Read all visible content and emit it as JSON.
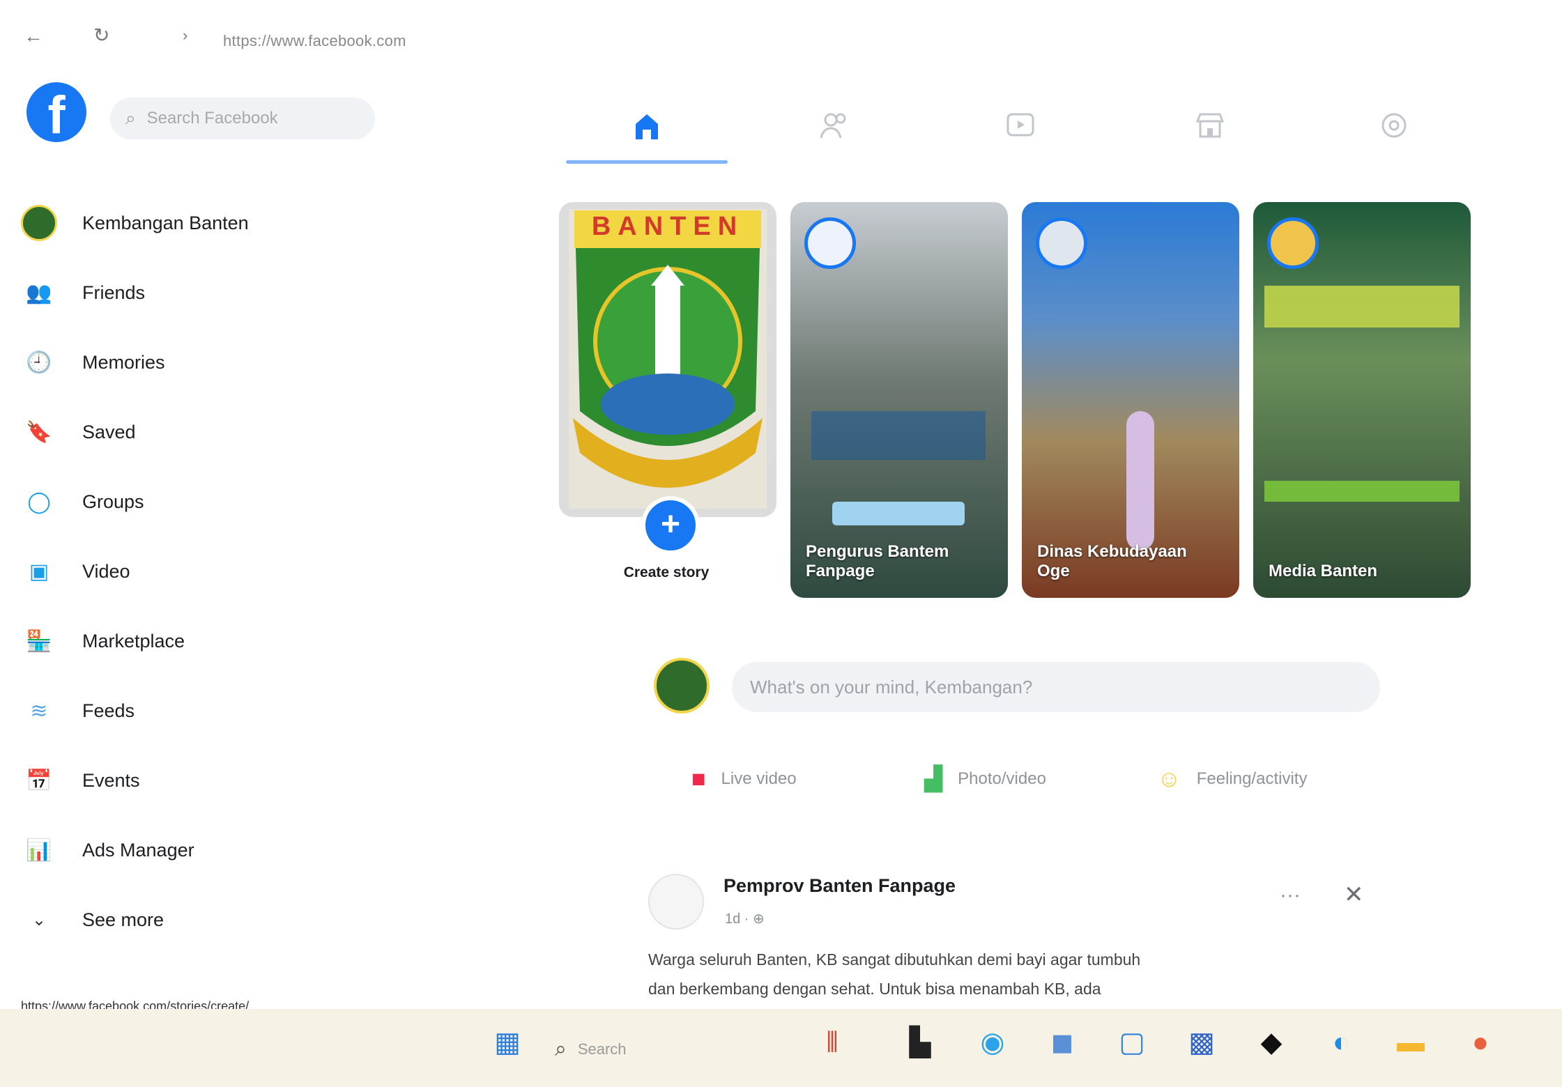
{
  "browser": {
    "back_icon": "back-arrow-icon",
    "reload_icon": "reload-icon",
    "url": "https://www.facebook.com"
  },
  "header": {
    "logo_letter": "f",
    "search_placeholder": "Search Facebook"
  },
  "nav_tabs": [
    {
      "name": "home",
      "icon": "home-icon",
      "active": true
    },
    {
      "name": "friends",
      "icon": "friends-icon",
      "active": false
    },
    {
      "name": "video",
      "icon": "video-icon",
      "active": false
    },
    {
      "name": "marketplace",
      "icon": "marketplace-icon",
      "active": false
    },
    {
      "name": "gaming",
      "icon": "gaming-icon",
      "active": false
    }
  ],
  "sidebar": {
    "items": [
      {
        "label": "Kembangan Banten",
        "icon": "profile-avatar"
      },
      {
        "label": "Friends",
        "icon": "friends-icon"
      },
      {
        "label": "Memories",
        "icon": "memories-icon"
      },
      {
        "label": "Saved",
        "icon": "saved-icon"
      },
      {
        "label": "Groups",
        "icon": "groups-icon"
      },
      {
        "label": "Video",
        "icon": "video-icon"
      },
      {
        "label": "Marketplace",
        "icon": "marketplace-icon"
      },
      {
        "label": "Feeds",
        "icon": "feeds-icon"
      },
      {
        "label": "Events",
        "icon": "events-icon"
      },
      {
        "label": "Ads Manager",
        "icon": "ads-manager-icon"
      },
      {
        "label": "See more",
        "icon": "chevron-down-icon"
      }
    ]
  },
  "status_bar": {
    "url": "https://www.facebook.com/stories/create/",
    "lang": "PS"
  },
  "stories": {
    "create_label": "Create story",
    "banner_text": "BANTEN",
    "items": [
      {
        "name": "Pengurus Bantem Fanpage"
      },
      {
        "name": "Dinas Kebudayaan Oge"
      },
      {
        "name": "Media Banten"
      }
    ]
  },
  "composer": {
    "placeholder": "What's on your mind, Kembangan?",
    "actions": [
      {
        "label": "Live video",
        "icon": "live-video-icon"
      },
      {
        "label": "Photo/video",
        "icon": "photo-icon"
      },
      {
        "label": "Feeling/activity",
        "icon": "feeling-icon"
      }
    ]
  },
  "post": {
    "author": "Pemprov Banten Fanpage",
    "meta": "1d · ⊕",
    "text_line1": "Warga seluruh Banten, KB sangat dibutuhkan demi bayi agar tumbuh",
    "text_line2": "dan berkembang dengan sehat. Untuk bisa menambah KB, ada"
  },
  "taskbar": {
    "search_placeholder": "Search"
  },
  "colors": {
    "accent": "#1877f2",
    "taskbar": "#f6f3e6"
  }
}
